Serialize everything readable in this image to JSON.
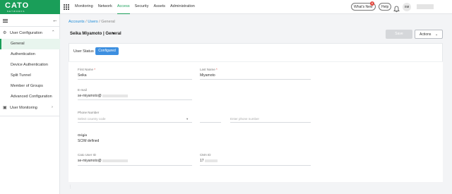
{
  "app": {
    "logo": "CATO",
    "logo_sub": "NETWORKS"
  },
  "nav": [
    "Monitoring",
    "Network",
    "Access",
    "Security",
    "Assets",
    "Administration"
  ],
  "nav_active": "Access",
  "header": {
    "whats_new": "What's New",
    "whats_new_count": "8",
    "help": "Help",
    "avatar_initials": "SM"
  },
  "sidebar": {
    "group_user_config": "User Configuration",
    "items": [
      "General",
      "Authentication",
      "Device Authentication",
      "Split Tunnel",
      "Member of Groups",
      "Advanced Configuration"
    ],
    "active_item": "General",
    "group_user_monitoring": "User Monitoring"
  },
  "breadcrumb": {
    "accounts": "Accounts",
    "sep": "/",
    "users": "Users",
    "current": "General"
  },
  "page": {
    "title": "Seika Miyamoto | General",
    "save_label": "Save",
    "actions_label": "Actions"
  },
  "status": {
    "label": "User Status",
    "value": "Configured"
  },
  "form": {
    "first_name_label": "First Name",
    "first_name_value": "Seika",
    "last_name_label": "Last Name",
    "last_name_value": "Miyamoto",
    "email_label": "E-mail",
    "email_value": "se-miyamoto@",
    "phone_label": "Phone Number",
    "country_placeholder": "Select country code",
    "phone_placeholder": "Enter phone number",
    "origin_label": "Origin",
    "origin_value": "SCIM defined",
    "cato_user_id_label": "Cato User ID",
    "cato_user_id_value": "se-miyamoto@",
    "cma_id_label": "CMA ID",
    "cma_id_value": "17",
    "required_mark": "*"
  },
  "colors": {
    "brand": "#1a9e59",
    "accent": "#3d8fe0",
    "link": "#1e8bd6"
  }
}
